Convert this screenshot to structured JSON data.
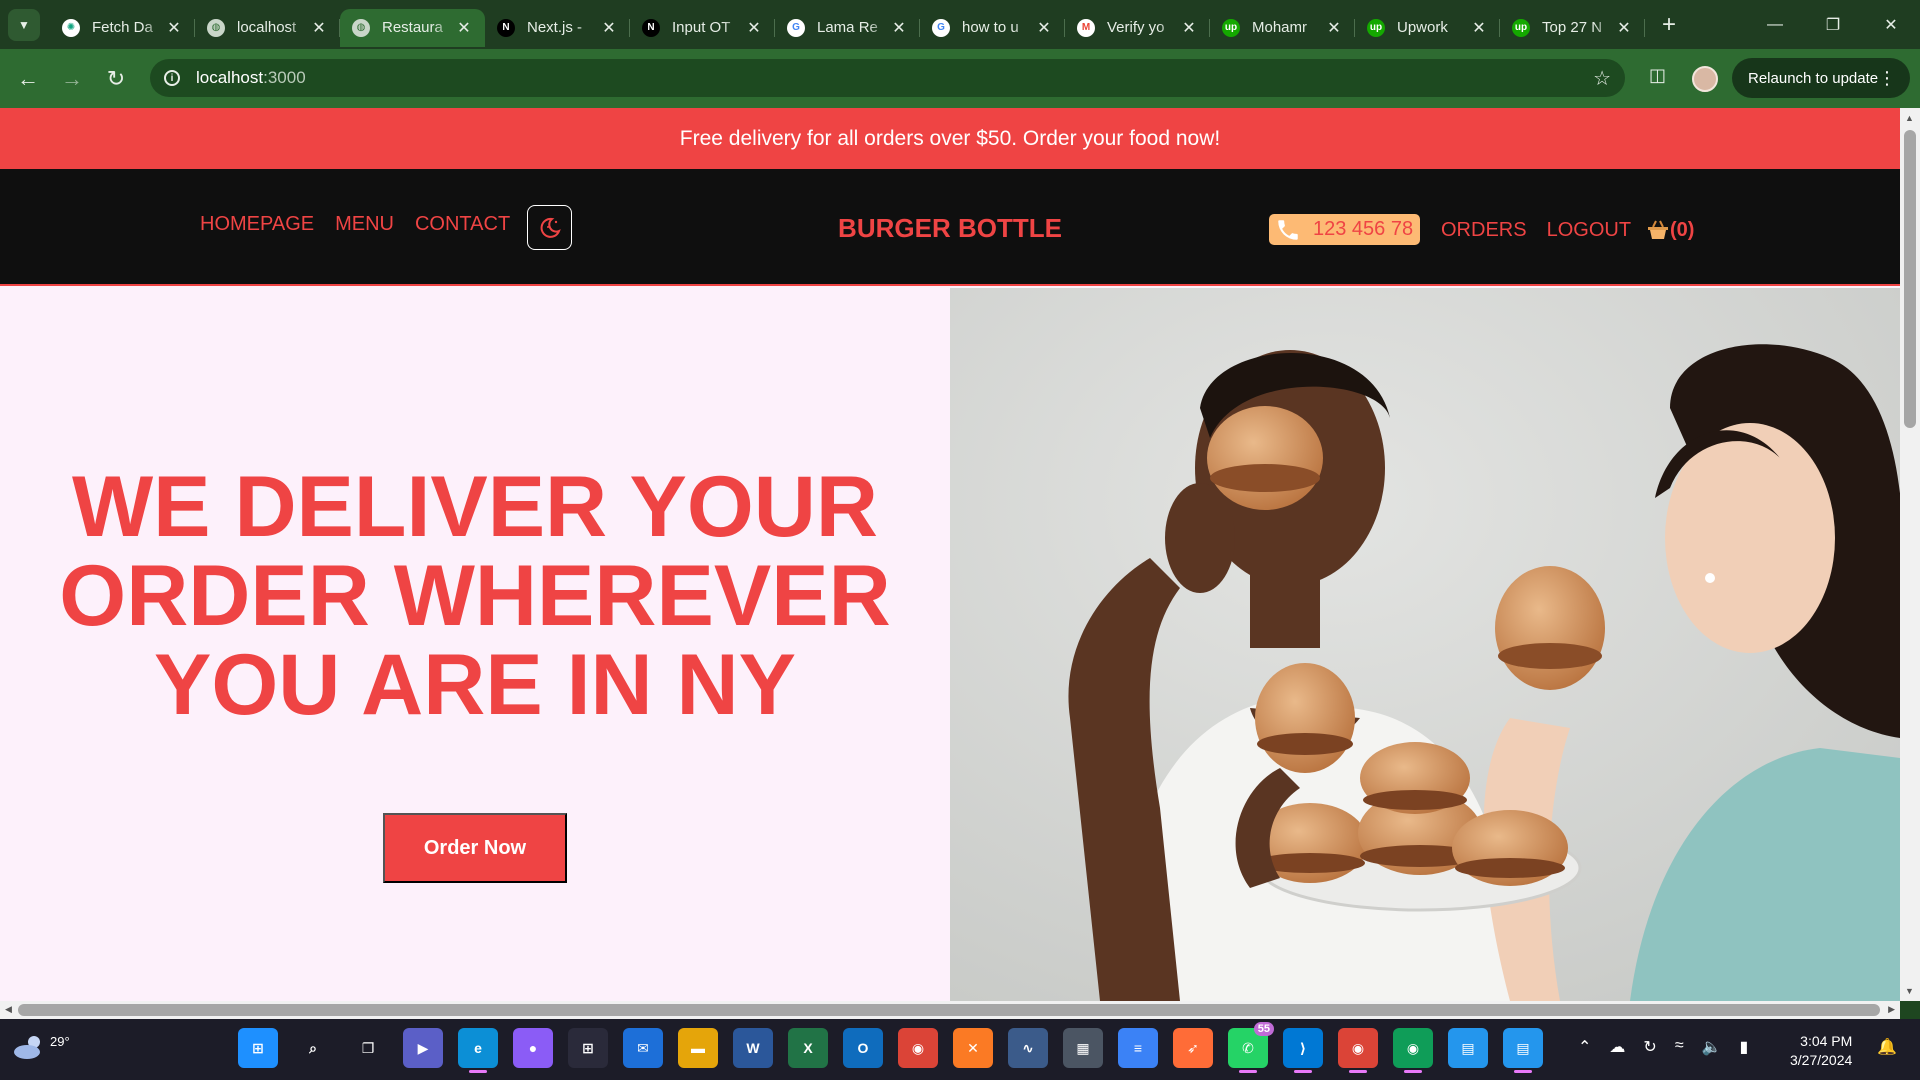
{
  "browser": {
    "tabs": [
      {
        "title": "Fetch Da",
        "icon": "chatgpt-icon",
        "active": false
      },
      {
        "title": "localhost",
        "icon": "globe-icon",
        "active": false
      },
      {
        "title": "Restaura",
        "icon": "globe-icon",
        "active": true
      },
      {
        "title": "Next.js -",
        "icon": "nextjs-icon",
        "active": false
      },
      {
        "title": "Input OT",
        "icon": "nextjs-icon",
        "active": false
      },
      {
        "title": "Lama Re",
        "icon": "google-icon",
        "active": false
      },
      {
        "title": "how to u",
        "icon": "google-icon",
        "active": false
      },
      {
        "title": "Verify yo",
        "icon": "gmail-icon",
        "active": false
      },
      {
        "title": "Mohamr",
        "icon": "upwork-icon",
        "active": false
      },
      {
        "title": "Upwork",
        "icon": "upwork-icon",
        "active": false
      },
      {
        "title": "Top 27 N",
        "icon": "upwork-icon",
        "active": false
      }
    ],
    "address": {
      "host": "localhost",
      "port": ":3000"
    },
    "relaunch_label": "Relaunch to update"
  },
  "page": {
    "promo": "Free delivery for all orders over $50. Order your food now!",
    "nav": {
      "left_links": [
        "HOMEPAGE",
        "MENU",
        "CONTACT"
      ],
      "brand": "BURGER BOTTLE",
      "phone": "123 456 78",
      "right_links": [
        "ORDERS",
        "LOGOUT"
      ],
      "cart_count": "(0)"
    },
    "hero": {
      "title_lines": [
        "WE DELIVER YOUR",
        "ORDER WHEREVER",
        "YOU ARE IN NY"
      ],
      "cta": "Order Now"
    },
    "colors": {
      "accent": "#ef4444",
      "nav_bg": "#0f0f0f",
      "hero_bg": "#fdf1fb",
      "phone_bg": "#fdba74"
    }
  },
  "taskbar": {
    "weather": "29°",
    "apps": [
      {
        "name": "windows-start-icon",
        "active": false
      },
      {
        "name": "search-icon",
        "active": false
      },
      {
        "name": "task-view-icon",
        "active": false
      },
      {
        "name": "teams-icon",
        "active": false
      },
      {
        "name": "edge-icon",
        "active": true
      },
      {
        "name": "github-desktop-icon",
        "active": false
      },
      {
        "name": "microsoft-store-icon",
        "active": false
      },
      {
        "name": "mail-icon",
        "active": false
      },
      {
        "name": "file-explorer-icon",
        "active": false
      },
      {
        "name": "word-icon",
        "active": false
      },
      {
        "name": "excel-icon",
        "active": false
      },
      {
        "name": "outlook-icon",
        "active": false
      },
      {
        "name": "chrome-icon",
        "active": false
      },
      {
        "name": "xampp-icon",
        "active": false
      },
      {
        "name": "performance-monitor-icon",
        "active": false
      },
      {
        "name": "calculator-icon",
        "active": false
      },
      {
        "name": "notepad-icon",
        "active": false
      },
      {
        "name": "postman-icon",
        "active": false
      },
      {
        "name": "whatsapp-icon",
        "active": true,
        "badge": "55"
      },
      {
        "name": "vscode-icon",
        "active": true
      },
      {
        "name": "chrome-profile-icon",
        "active": true
      },
      {
        "name": "chrome-profile-2-icon",
        "active": true
      },
      {
        "name": "docker-icon",
        "active": false
      },
      {
        "name": "docker-2-icon",
        "active": true
      }
    ],
    "time": "3:04 PM",
    "date": "3/27/2024"
  }
}
